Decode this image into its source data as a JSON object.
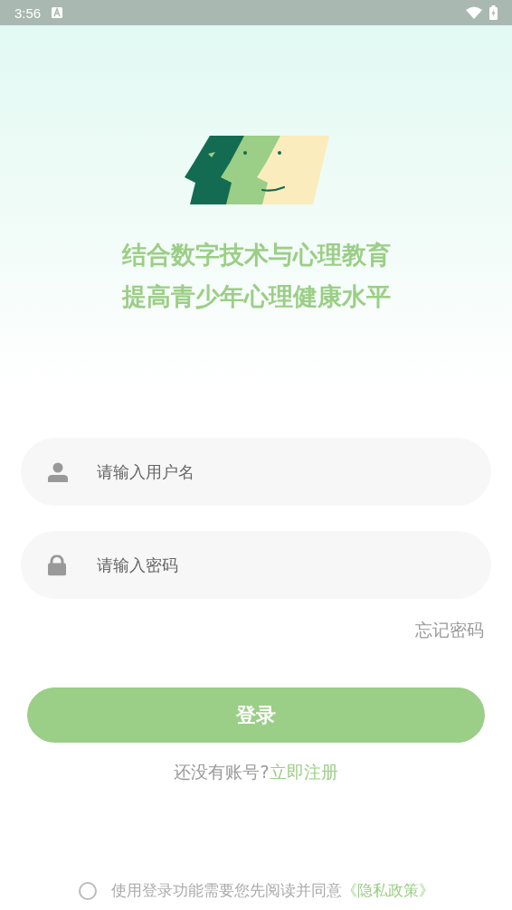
{
  "status_bar": {
    "time": "3:56"
  },
  "slogan": [
    "结合数字技术与心理教育",
    "提高青少年心理健康水平"
  ],
  "username": {
    "placeholder": "请输入用户名"
  },
  "password": {
    "placeholder": "请输入密码"
  },
  "forgot_password": "忘记密码",
  "login_button": "登录",
  "register": {
    "prompt": "还没有账号?",
    "link": "立即注册"
  },
  "agreement": {
    "checked": false,
    "text": "使用登录功能需要您先阅读并同意",
    "link": "《隐私政策》"
  }
}
